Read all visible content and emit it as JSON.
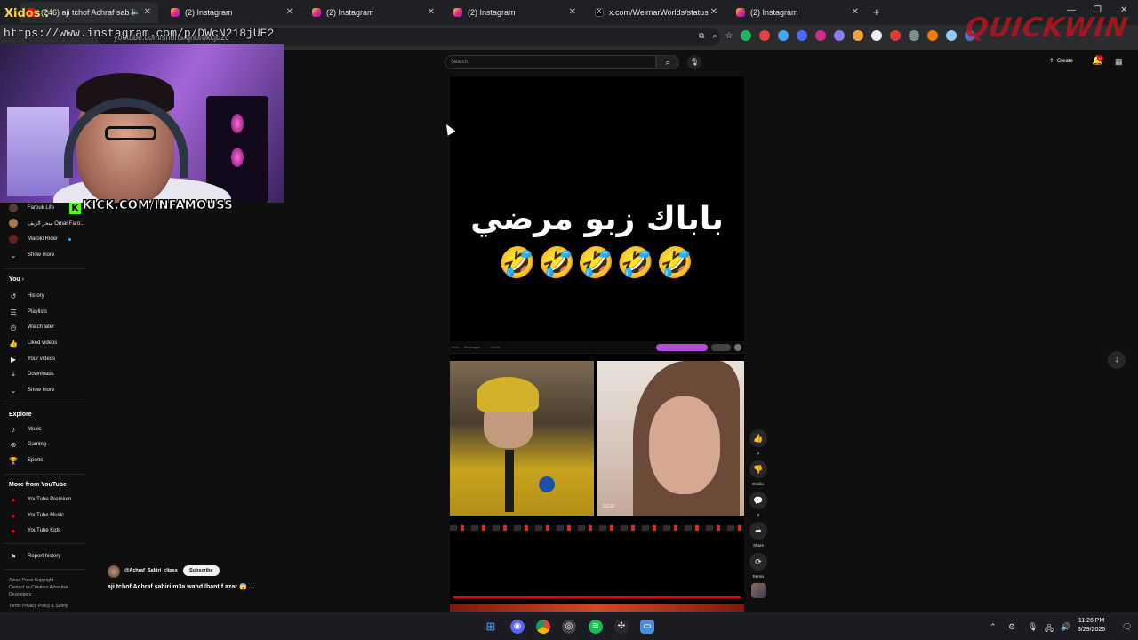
{
  "overlay": {
    "streamer_tag": "Xidos :",
    "url_text": "https://www.instagram.com/p/DWcN218jUE2",
    "kick_logo": "K",
    "kick_text": "KICK.COM/INFAMOUSS",
    "brand": "QUICKWIN"
  },
  "browser": {
    "tabs": [
      {
        "label": "(246) aji tchof Achraf sabiri",
        "favicon": "youtube-icon",
        "active": true
      },
      {
        "label": "(2) Instagram",
        "favicon": "instagram-icon",
        "active": false
      },
      {
        "label": "(2) Instagram",
        "favicon": "instagram-icon",
        "active": false
      },
      {
        "label": "(2) Instagram",
        "favicon": "instagram-icon",
        "active": false
      },
      {
        "label": "x.com/WeimarWorlds/status/20",
        "favicon": "x-icon",
        "active": false
      },
      {
        "label": "(2) Instagram",
        "favicon": "instagram-icon",
        "active": false
      }
    ],
    "address": "youtube.com/shorts/qnbrokcjb2c"
  },
  "youtube": {
    "search_placeholder": "Search",
    "create_label": "Create",
    "notifications_count": "9+",
    "sidebar": {
      "subscriptions": [
        {
          "label": "Farouk Life",
          "avatar_color": "#5a3d2e"
        },
        {
          "label": "سحر الريف Omar Faro...",
          "avatar_color": "#a77c4a"
        },
        {
          "label": "Maroki Rider",
          "avatar_color": "#6a1f1f",
          "live": true
        }
      ],
      "show_more_1": "Show more",
      "you_heading": "You",
      "you_items": [
        "History",
        "Playlists",
        "Watch later",
        "Liked videos",
        "Your videos",
        "Downloads"
      ],
      "show_more_2": "Show more",
      "explore_heading": "Explore",
      "explore_items": [
        "Music",
        "Gaming",
        "Sports"
      ],
      "more_heading": "More from YouTube",
      "more_items": [
        "YouTube Premium",
        "YouTube Music",
        "YouTube Kids"
      ],
      "report_history": "Report history",
      "footer_line1": "About  Press  Copyright",
      "footer_line2": "Contact us  Creators  Advertise",
      "footer_line3": "Developers",
      "footer_line4": "Terms  Privacy  Policy & Safety"
    },
    "short": {
      "caption_arabic": "باباك زبو مرضي",
      "caption_emojis": "🤣🤣🤣🤣🤣",
      "azar_tabs": [
        "feed",
        "Messages",
        "About"
      ],
      "cam_label": "azar",
      "progress": 1.0
    },
    "actions": {
      "like_count": "2",
      "dislike_label": "Dislike",
      "comment_count": "0",
      "share_label": "Share",
      "remix_label": "Remix"
    },
    "channel": {
      "handle": "@Achraf_Sabiri_clipss",
      "subscribe_label": "Subscribe",
      "title": "aji tchof Achraf sabiri m3a wahd lbant f azar 😱 ..."
    }
  },
  "taskbar": {
    "time": "11:26 PM",
    "date": "3/29/2026"
  },
  "colors": {
    "accent_red": "#ff0000",
    "kick_green": "#53fc18",
    "background": "#0f0f0f"
  }
}
